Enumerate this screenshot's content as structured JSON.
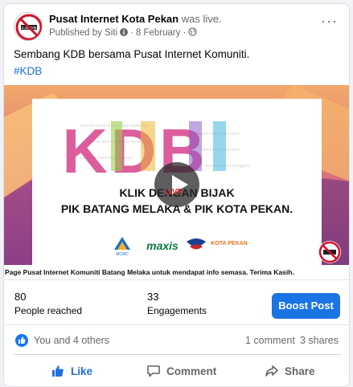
{
  "post": {
    "page_name": "Pusat Internet Kota Pekan",
    "was_live": "was live.",
    "published_by": "Published by Siti",
    "date": "8 February",
    "text": "Sembang KDB bersama Pusat Internet Komuniti.",
    "hashtag": "#KDB",
    "avatar_label": "C-19-RTB",
    "more_label": "···"
  },
  "media": {
    "title": "KDB",
    "live_badge": "LIVE",
    "line1": "KLIK DENGAN BIJAK",
    "line2": "PIK BATANG MELAKA & PIK KOTA PEKAN.",
    "logos": [
      "MCMC",
      "maxis",
      "",
      "KOTA PEKAN"
    ],
    "ticker": "Page Pusat Internet Komuniti Batang Melaka untuk mendapat info semasa. Terima Kasih."
  },
  "stats": {
    "reached_count": "80",
    "reached_label": "People reached",
    "engagements_count": "33",
    "engagements_label": "Engagements",
    "boost_label": "Boost Post"
  },
  "reactions": {
    "text": "You and 4 others",
    "comments": "1 comment",
    "shares": "3 shares"
  },
  "actions": {
    "like": "Like",
    "comment": "Comment",
    "share": "Share"
  },
  "colors": {
    "accent": "#1b74e4",
    "liked": "#216fdb"
  }
}
